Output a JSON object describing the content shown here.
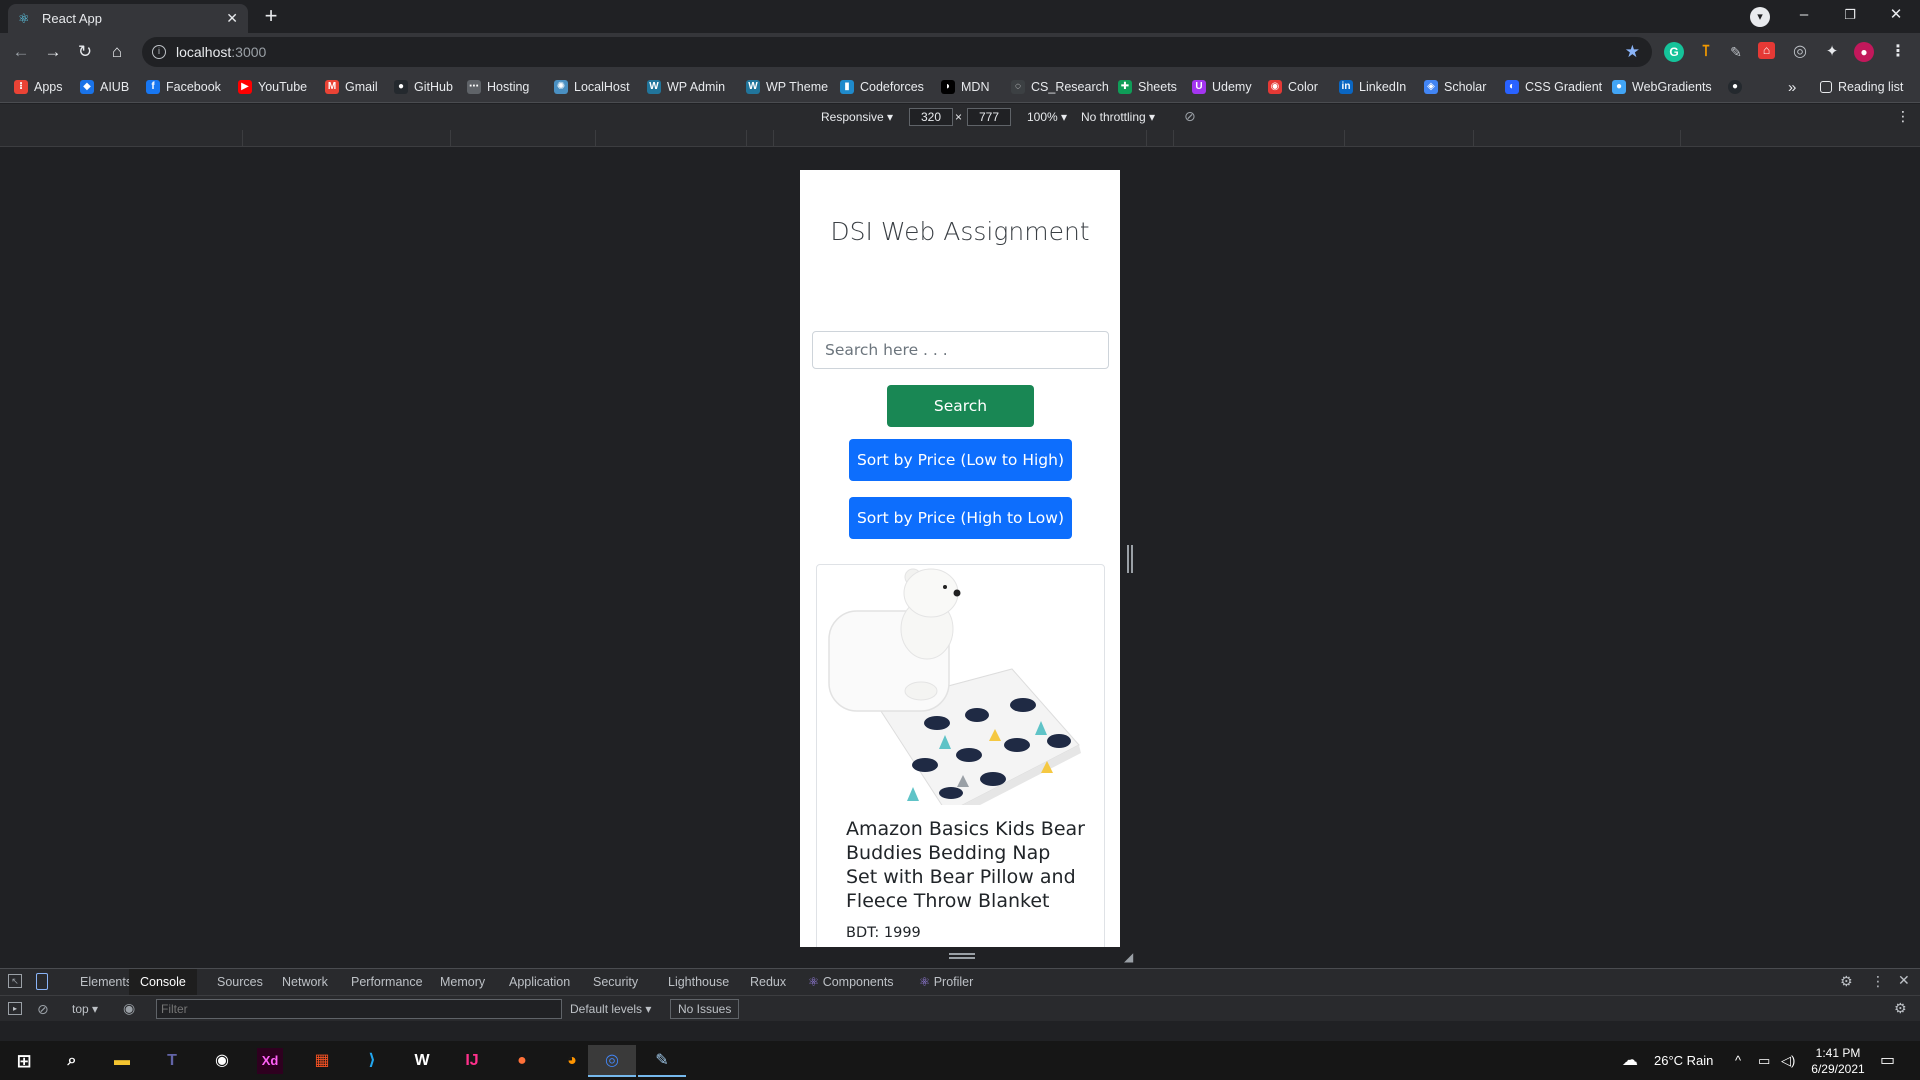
{
  "browser": {
    "tab_title": "React App",
    "new_tab": "+",
    "url_host": "localhost",
    "url_port": ":3000",
    "window_controls": [
      "–",
      "❐",
      "✕"
    ]
  },
  "bookmarks": [
    {
      "label": "Apps",
      "color": "#ea4335",
      "glyph": "⁝"
    },
    {
      "label": "AIUB",
      "color": "#1a73e8",
      "glyph": "◆"
    },
    {
      "label": "Facebook",
      "color": "#1877f2",
      "glyph": "f"
    },
    {
      "label": "YouTube",
      "color": "#ff0000",
      "glyph": "▶"
    },
    {
      "label": "Gmail",
      "color": "#ea4335",
      "glyph": "M"
    },
    {
      "label": "GitHub",
      "color": "#24292e",
      "glyph": "●"
    },
    {
      "label": "Hosting",
      "color": "#5f6368",
      "glyph": "⋯"
    },
    {
      "label": "LocalHost",
      "color": "#4a90c2",
      "glyph": "✺"
    },
    {
      "label": "WP Admin",
      "color": "#21759b",
      "glyph": "W"
    },
    {
      "label": "WP Theme",
      "color": "#21759b",
      "glyph": "W"
    },
    {
      "label": "Codeforces",
      "color": "#1f8acb",
      "glyph": "▮"
    },
    {
      "label": "MDN",
      "color": "#000000",
      "glyph": "◗"
    },
    {
      "label": "CS_Research",
      "color": "#3c4043",
      "glyph": "◌"
    },
    {
      "label": "Sheets",
      "color": "#0f9d58",
      "glyph": "✚"
    },
    {
      "label": "Udemy",
      "color": "#a435f0",
      "glyph": "U"
    },
    {
      "label": "Color",
      "color": "#e53935",
      "glyph": "◉"
    },
    {
      "label": "LinkedIn",
      "color": "#0a66c2",
      "glyph": "in"
    },
    {
      "label": "Scholar",
      "color": "#4285f4",
      "glyph": "◈"
    },
    {
      "label": "CSS Gradient",
      "color": "#2962ff",
      "glyph": "◐"
    },
    {
      "label": "WebGradients",
      "color": "#42a5f5",
      "glyph": "●"
    }
  ],
  "bookmarks_overflow": "»",
  "reading_list": "Reading list",
  "device_toolbar": {
    "mode": "Responsive ▾",
    "width": "320",
    "times": "×",
    "height": "777",
    "zoom": "100% ▾",
    "throttle": "No throttling ▾"
  },
  "app": {
    "title": "DSI Web Assignment",
    "search_placeholder": "Search here . . .",
    "search_button": "Search",
    "sort_low": "Sort by Price (Low to High)",
    "sort_high": "Sort by Price (High to Low)",
    "product": {
      "title": "Amazon Basics Kids Bear Buddies Bedding Nap Set with Bear Pillow and Fleece Throw Blanket",
      "price": "BDT: 1999"
    }
  },
  "devtools": {
    "tabs": [
      "Elements",
      "Console",
      "Sources",
      "Network",
      "Performance",
      "Memory",
      "Application",
      "Security",
      "Lighthouse",
      "Redux",
      "Components",
      "Profiler"
    ],
    "context": "top ▾",
    "filter_placeholder": "Filter",
    "levels": "Default levels ▾",
    "issues": "No Issues"
  },
  "taskbar": {
    "weather": "26°C  Rain",
    "time": "1:41 PM",
    "date": "6/29/2021"
  },
  "colors": {
    "search_green": "#198754",
    "sort_blue": "#0d6efd"
  }
}
